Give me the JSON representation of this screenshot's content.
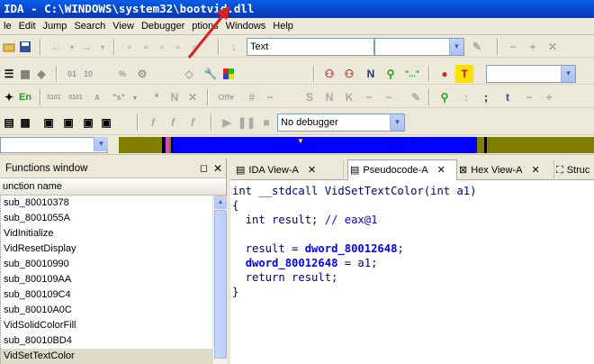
{
  "window": {
    "title": "IDA - C:\\WINDOWS\\system32\\bootvid.dll"
  },
  "menu": [
    "le",
    "Edit",
    "Jump",
    "Search",
    "View",
    "Debugger",
    "ptions",
    "Windows",
    "Help"
  ],
  "toolbar": {
    "type_combo": "Text",
    "debugger_combo": "No debugger",
    "en_label": "En"
  },
  "functions_window": {
    "title": "Functions window",
    "column": "unction name",
    "items": [
      "sub_80010378",
      "sub_8001055A",
      "VidInitialize",
      "VidResetDisplay",
      "sub_80010990",
      "sub_800109AA",
      "sub_800109C4",
      "sub_80010A0C",
      "VidSolidColorFill",
      "sub_80010BD4",
      "VidSetTextColor"
    ],
    "selected_index": 10
  },
  "tabs": [
    {
      "label": "IDA View-A",
      "icon": "ida-view-icon"
    },
    {
      "label": "Pseudocode-A",
      "icon": "pseudocode-icon"
    },
    {
      "label": "Hex View-A",
      "icon": "hex-view-icon"
    },
    {
      "label": "Struc",
      "icon": "structures-icon"
    }
  ],
  "code": {
    "line1": "int __stdcall VidSetTextColor(int a1)",
    "line2": "{",
    "line3_a": "  int result; ",
    "line3_b": "// eax@1",
    "line4": "",
    "line5_a": "  result = ",
    "line5_b": "dword_80012648",
    "line5_c": ";",
    "line6_a": "  ",
    "line6_b": "dword_80012648",
    "line6_c": " = a1;",
    "line7": "  return result;",
    "line8": "}"
  },
  "colors": {
    "title_bar": "#0843c4",
    "nav_band": "#808000",
    "nav_code": "#0000ff",
    "highlight": "#dfdbc9"
  }
}
